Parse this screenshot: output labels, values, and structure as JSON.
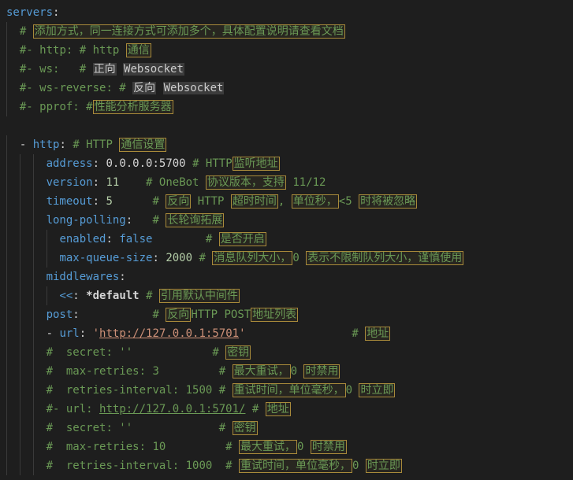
{
  "k_servers": "servers",
  "c_add": "添加方式，同一连接方式可添加多个，具体配置说明请查看文档",
  "c_http_prefix": "- http: # http ",
  "c_http_word": "通信",
  "c_ws_prefix": "- ws:   # ",
  "c_ws_word1": "正向",
  "c_ws_word2": "Websocket",
  "c_wsr_prefix": "- ws-reverse: # ",
  "c_wsr_word1": "反向",
  "c_wsr_word2": "Websocket",
  "c_pprof_prefix": "- pprof: #",
  "c_pprof_word": "性能分析服务器",
  "k_http": "http",
  "c_httpset_prefix": "# HTTP ",
  "c_httpset_word": "通信设置",
  "k_address": "address",
  "v_address": "0.0.0.0:5700",
  "c_addr_prefix": "# HTTP",
  "c_addr_word": "监听地址",
  "k_version": "version",
  "v_version": "11",
  "c_ver_prefix": "# OneBot ",
  "c_ver_word1": "协议版本，支持",
  "c_ver_suffix": " 11/12",
  "k_timeout": "timeout",
  "v_timeout": "5",
  "c_to_w1": "反向",
  "c_to_mid": " HTTP ",
  "c_to_w2": "超时时间",
  "c_to_w3": "单位秒，",
  "c_to_lt": "<5 ",
  "c_to_w4": "时将被忽略",
  "k_longpoll": "long-polling",
  "c_lp_word": "长轮询拓展",
  "k_enabled": "enabled",
  "v_enabled": "false",
  "c_en_word": "是否开启",
  "k_mqs": "max-queue-size",
  "v_mqs": "2000",
  "c_mq_w1": "消息队列大小，",
  "c_mq_zero": "0 ",
  "c_mq_w2": "表示不限制队列大小，谨慎使用",
  "k_mw": "middlewares",
  "k_merge": "<<",
  "v_default": "default",
  "c_mw_word": "引用默认中间件",
  "k_post": "post",
  "c_post_w1": "反向",
  "c_post_mid": "HTTP POST",
  "c_post_w2": "地址列表",
  "k_url": "url",
  "v_url": "http://127.0.0.1:5701",
  "c_url_word": "地址",
  "c_secret_prefix": "  secret: ''",
  "c_secret_word": "密钥",
  "c_mr3_prefix": "  max-retries: 3",
  "c_mr_word1": "最大重试，",
  "c_mr_zero": "0 ",
  "c_mr_word2": "时禁用",
  "c_ri1500_prefix": "  retries-interval: 1500",
  "c_ri_word1": "重试时间，单位毫秒，",
  "c_ri_zero": "0 ",
  "c_ri_word2": "时立即",
  "c_url2_prefix": "- url: ",
  "c_url2_val": "http://127.0.0.1:5701/",
  "c_url2_word": "地址",
  "c_mr10_prefix": "  max-retries: 10",
  "c_ri1000_prefix": "  retries-interval: 1000"
}
